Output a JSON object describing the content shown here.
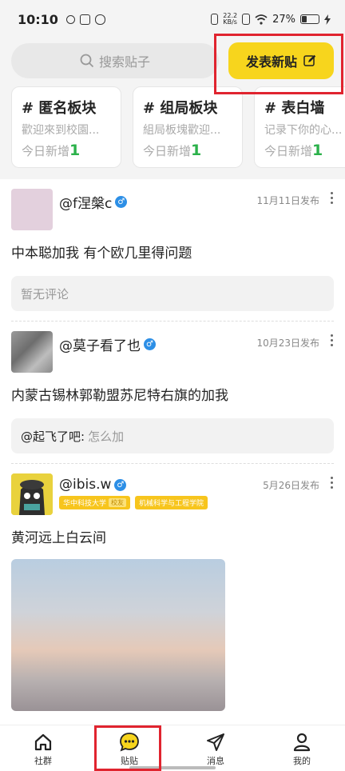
{
  "status_bar": {
    "time": "10:10",
    "net_speed_value": "22.2",
    "net_speed_unit": "KB/s",
    "battery": "27%",
    "battery_level": 0.27
  },
  "search": {
    "placeholder": "搜索贴子"
  },
  "post_button": {
    "label": "发表新贴"
  },
  "boards": [
    {
      "title": "# 匿名板块",
      "desc": "歡迎來到校園...",
      "stat_label": "今日新增",
      "stat_value": "1"
    },
    {
      "title": "# 组局板块",
      "desc": "組局板塊歡迎...",
      "stat_label": "今日新增",
      "stat_value": "1"
    },
    {
      "title": "# 表白墙",
      "desc": "记录下你的心...",
      "stat_label": "今日新增",
      "stat_value": "1"
    }
  ],
  "posts": [
    {
      "username": "@f涅槃c",
      "date": "11月11日发布",
      "text": "中本聪加我 有个欧几里得问题",
      "comment_author": "",
      "comment_text": "暂无评论"
    },
    {
      "username": "@莫子看了也",
      "date": "10月23日发布",
      "text": "内蒙古锡林郭勒盟苏尼特右旗的加我",
      "comment_author": "@起飞了吧:",
      "comment_text": "怎么加"
    },
    {
      "username": "@ibis.w",
      "date": "5月26日发布",
      "tag1": "华中科技大学",
      "tag1_sub": "校友",
      "tag2": "机械科学与工程学院",
      "text": "黄河远上白云间"
    }
  ],
  "nav": [
    {
      "label": "社群",
      "icon": "home-icon"
    },
    {
      "label": "贴贴",
      "icon": "chat-bubble-icon"
    },
    {
      "label": "消息",
      "icon": "send-icon"
    },
    {
      "label": "我的",
      "icon": "person-icon"
    }
  ],
  "colors": {
    "accent": "#f7d51d",
    "highlight": "#e0242f",
    "stat_green": "#2bb14a",
    "male_badge": "#2d8fe6"
  }
}
